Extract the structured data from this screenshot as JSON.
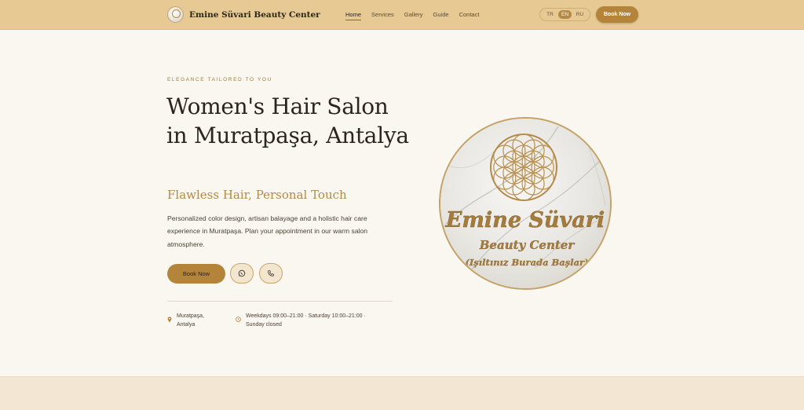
{
  "header": {
    "brand": "Emine Süvari Beauty Center",
    "nav": [
      {
        "label": "Home",
        "active": true
      },
      {
        "label": "Services"
      },
      {
        "label": "Gallery"
      },
      {
        "label": "Guide"
      },
      {
        "label": "Contact"
      }
    ],
    "languages": [
      {
        "code": "TR"
      },
      {
        "code": "EN",
        "active": true
      },
      {
        "code": "RU"
      }
    ],
    "book_label": "Book Now"
  },
  "hero": {
    "eyebrow": "ELEGANCE TAILORED TO YOU",
    "title": "Women's Hair Salon in Muratpaşa, Antalya",
    "subtitle": "Flawless Hair, Personal Touch",
    "description": "Personalized color design, artisan balayage and a holistic hair care experience in Muratpaşa. Plan your appointment in our warm salon atmosphere.",
    "book_label": "Book Now",
    "location": "Muratpaşa, Antalya",
    "hours": "Weekdays 09:00–21:00 · Saturday 10:00–21:00 · Sunday closed"
  },
  "logo": {
    "line1": "Emine Süvari",
    "line2": "Beauty Center",
    "line3": "(Işıltınız Burada Başlar)"
  },
  "icons": {
    "whatsapp": "whatsapp-icon",
    "phone": "phone-icon",
    "location": "location-pin-icon",
    "hours": "clock-icon"
  },
  "colors": {
    "header_bg": "#e6c993",
    "accent": "#b5843b",
    "page_bg": "#faf7f0",
    "gold_text": "#b08a4c",
    "band_bg": "#f3e6d3"
  }
}
